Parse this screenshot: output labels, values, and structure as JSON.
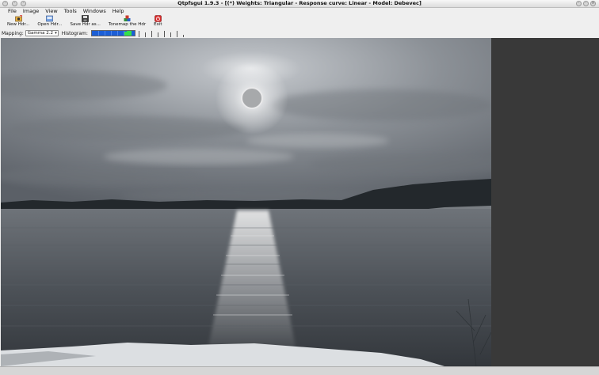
{
  "window": {
    "title": "Qtpfsgui 1.9.3 - [(*) Weights: Triangular - Response curve: Linear - Model: Debevec]",
    "colors": {
      "accent": "#1c5fd6",
      "histogram_peak": "#33e04a",
      "workspace": "#393939"
    }
  },
  "menu": [
    {
      "label": "File"
    },
    {
      "label": "Image"
    },
    {
      "label": "View"
    },
    {
      "label": "Tools"
    },
    {
      "label": "Windows"
    },
    {
      "label": "Help"
    }
  ],
  "toolbar": [
    {
      "label": "New Hdr...",
      "icon": "new-hdr-icon"
    },
    {
      "label": "Open Hdr...",
      "icon": "open-hdr-icon"
    },
    {
      "label": "Save Hdr as...",
      "icon": "save-icon"
    },
    {
      "label": "Tonemap the Hdr",
      "icon": "tonemap-icon"
    },
    {
      "label": "Exit",
      "icon": "exit-icon"
    }
  ],
  "options": {
    "mapping_label": "Mapping:",
    "mapping_value": "Gamma 2.2",
    "histogram_label": "Histogram:"
  },
  "image": {
    "icon": "hdr-landscape-image"
  }
}
